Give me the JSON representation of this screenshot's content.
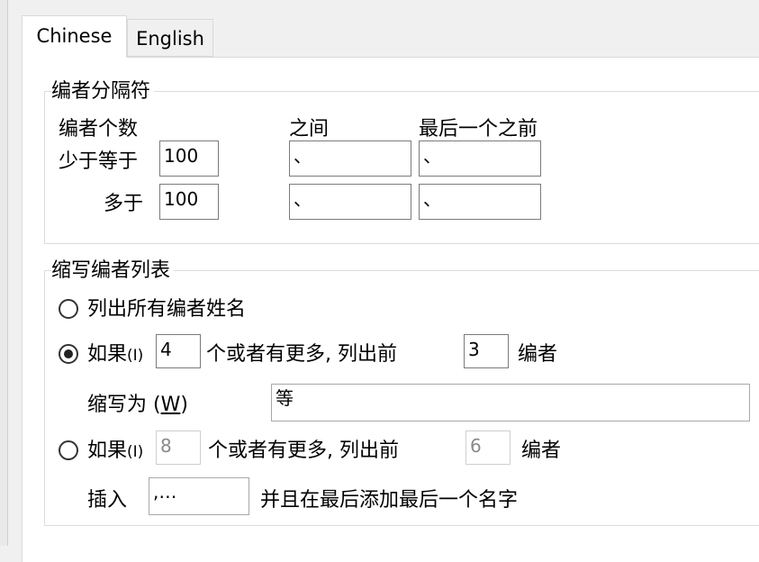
{
  "tabs": [
    {
      "label": "Chinese",
      "active": true
    },
    {
      "label": "English",
      "active": false
    }
  ],
  "separators": {
    "title": "编者分隔符",
    "count_header": "编者个数",
    "between_header": "之间",
    "before_last_header": "最后一个之前",
    "row1": {
      "label": "少于等于",
      "count": "100",
      "between": "、",
      "before_last": "、"
    },
    "row2": {
      "label": "多于",
      "count": "100",
      "between": "、",
      "before_last": "、"
    }
  },
  "abbrev": {
    "title": "缩写编者列表",
    "option_all": "列出所有编者姓名",
    "option_if": {
      "prefix": "如果",
      "hotkey": "(I)",
      "min": "4",
      "middle": "个或者有更多, 列出前",
      "first": "3",
      "suffix": "编者",
      "selected": true
    },
    "abbreviate_label_prefix": "缩写为 (",
    "abbreviate_label_key": "W",
    "abbreviate_label_suffix": ")",
    "abbreviate_value": "等",
    "option_if2": {
      "prefix": "如果",
      "hotkey": "(I)",
      "min": "8",
      "middle": "个或者有更多, 列出前",
      "first": "6",
      "suffix": "编者",
      "selected": false
    },
    "insert_label": "插入",
    "insert_value": ",…",
    "insert_suffix": "并且在最后添加最后一个名字"
  }
}
